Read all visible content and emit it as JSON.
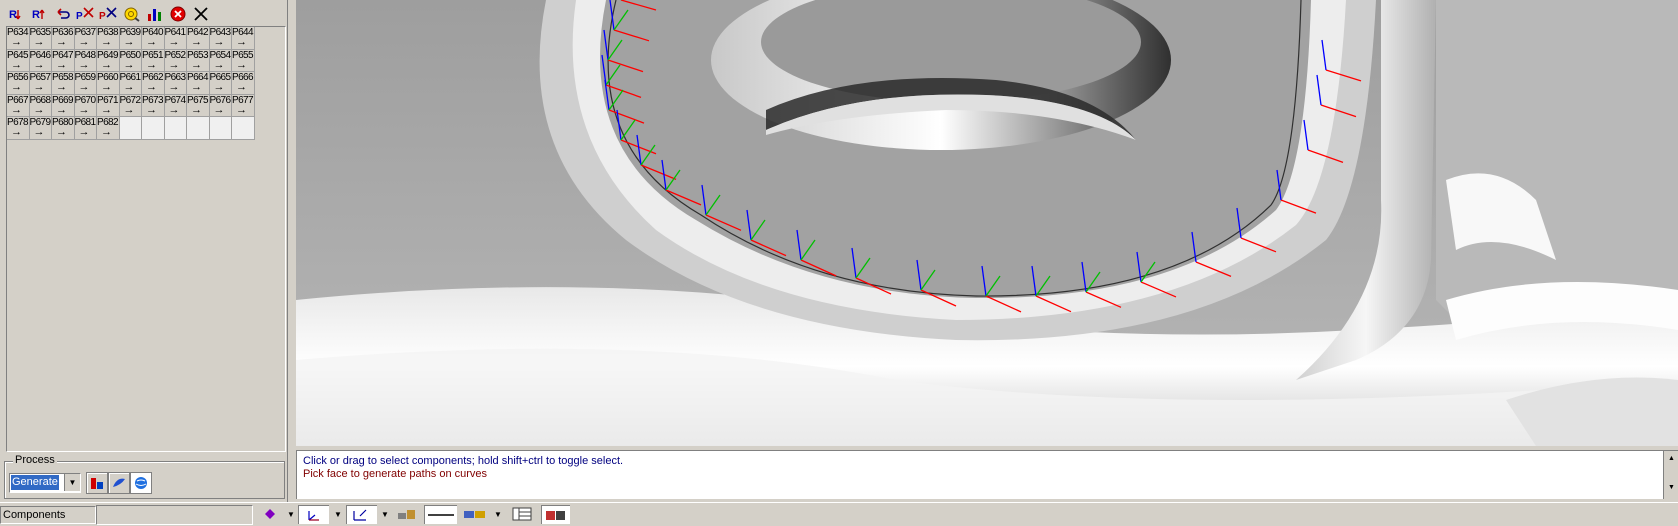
{
  "toolbar": {
    "buttons": [
      {
        "name": "rename-icon",
        "glyph": "R"
      },
      {
        "name": "rename-sorted-icon",
        "glyph": "R"
      },
      {
        "name": "undo-icon",
        "glyph": "↺"
      },
      {
        "name": "delete-selected-icon",
        "glyph": "×"
      },
      {
        "name": "delete-all-icon",
        "glyph": "×"
      },
      {
        "name": "find-icon",
        "glyph": "◎"
      },
      {
        "name": "chart-icon",
        "glyph": "▐"
      },
      {
        "name": "stop-icon",
        "glyph": "✖"
      },
      {
        "name": "close-icon",
        "glyph": "✕"
      }
    ]
  },
  "points": [
    "P634",
    "P635",
    "P636",
    "P637",
    "P638",
    "P639",
    "P640",
    "P641",
    "P642",
    "P643",
    "P644",
    "P645",
    "P646",
    "P647",
    "P648",
    "P649",
    "P650",
    "P651",
    "P652",
    "P653",
    "P654",
    "P655",
    "P656",
    "P657",
    "P658",
    "P659",
    "P660",
    "P661",
    "P662",
    "P663",
    "P664",
    "P665",
    "P666",
    "P667",
    "P668",
    "P669",
    "P670",
    "P671",
    "P672",
    "P673",
    "P674",
    "P675",
    "P676",
    "P677",
    "P678",
    "P679",
    "P680",
    "P681",
    "P682"
  ],
  "point_arrow": "→",
  "process": {
    "title": "Process",
    "selected": "Generate",
    "buttons": [
      "generate-paths-icon",
      "surface-icon",
      "globe-icon"
    ]
  },
  "messages": {
    "line1": "Click or drag to select components; hold shift+ctrl to toggle select.",
    "line2": "Pick face to generate paths on curves"
  },
  "status": {
    "label": "Components"
  },
  "colors": {
    "frame_x": "#ff0000",
    "frame_y": "#00c000",
    "frame_z": "#0000ff",
    "msg_info": "#000080",
    "msg_prompt": "#800000",
    "selection": "#316ac5"
  }
}
